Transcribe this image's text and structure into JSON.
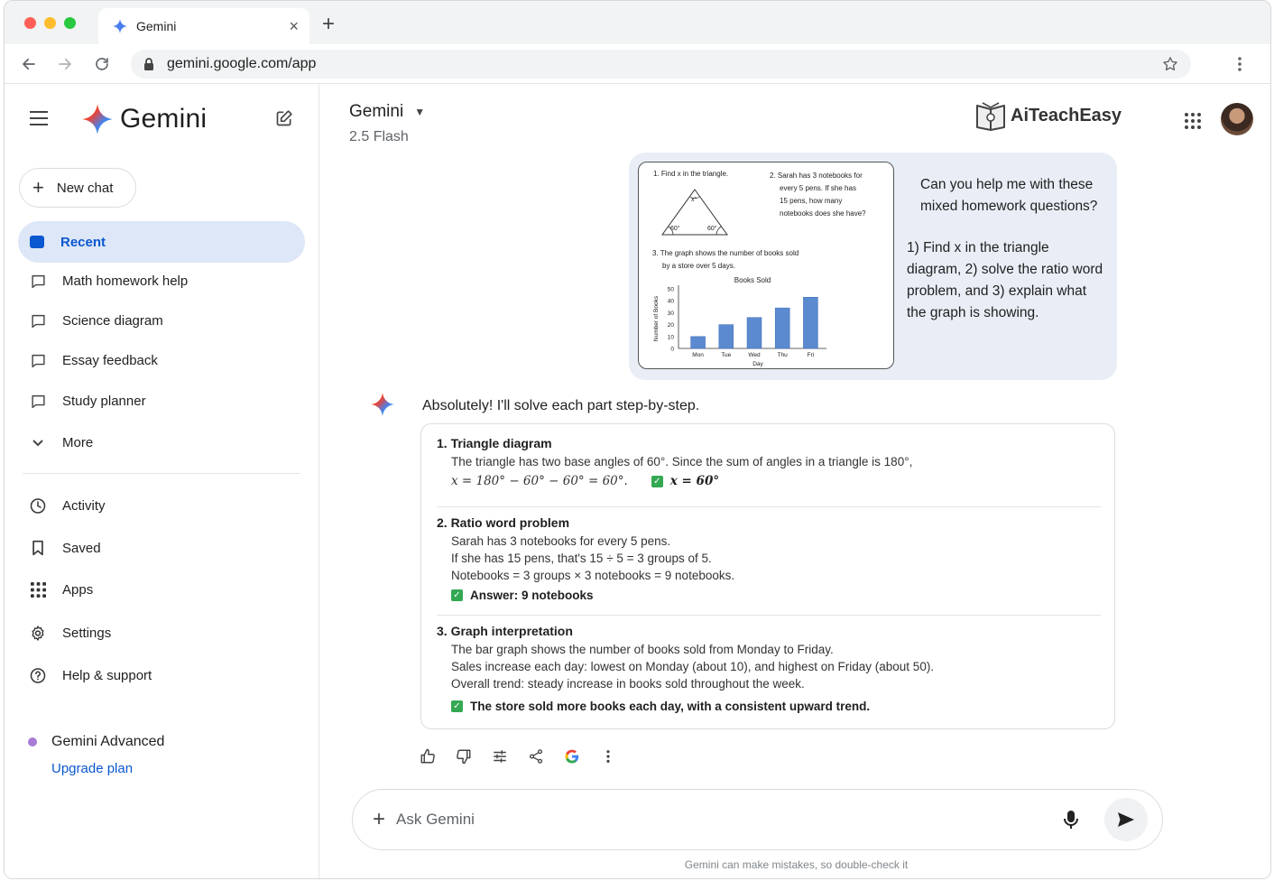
{
  "browser": {
    "tab_title": "Gemini",
    "tab_close": "×",
    "new_tab": "+",
    "url": "gemini.google.com/app"
  },
  "sidebar": {
    "brand": "Gemini",
    "new_chat": "New chat",
    "recent": "Recent",
    "chats": [
      "Math homework help",
      "Science diagram",
      "Essay feedback",
      "Study planner"
    ],
    "more": "More",
    "menu": [
      "Activity",
      "Saved",
      "Apps",
      "Settings",
      "Help & support"
    ],
    "advanced": "Gemini Advanced",
    "upgrade": "Upgrade plan"
  },
  "header": {
    "model_name": "Gemini",
    "model_version": "2.5 Flash",
    "partner_logo": "AiTeachEasy"
  },
  "user_message": {
    "question": "Can you help me with these mixed homework questions?",
    "details": "1) Find x in the triangle diagram, 2) solve the ratio word problem, and 3) explain what the graph is showing.",
    "worksheet": {
      "q1": "1. Find x in the triangle.",
      "angle_left": "60°",
      "angle_right": "60°",
      "angle_top": "x°",
      "q2_lines": [
        "2. Sarah has 3 notebooks for",
        "every 5 pens. If she has",
        "15 pens, how many",
        "notebooks does she have?"
      ],
      "q3_lines": [
        "3. The graph shows the number of books sold",
        "by a store over 5 days."
      ]
    }
  },
  "chart_data": {
    "type": "bar",
    "title": "Books Sold",
    "xlabel": "Day",
    "ylabel": "Number of Books",
    "categories": [
      "Mon",
      "Tue",
      "Wed",
      "Thu",
      "Fri"
    ],
    "values": [
      10,
      20,
      26,
      34,
      43
    ],
    "ylim": [
      0,
      50
    ],
    "yticks": [
      0,
      10,
      20,
      30,
      40,
      50
    ],
    "grid": false,
    "bar_color": "#5b8ad0"
  },
  "answer": {
    "intro": "Absolutely! I'll solve each part step-by-step.",
    "s1": {
      "heading": "1. Triangle diagram",
      "line1": "The triangle has two base angles of 60°. Since the sum of angles in a triangle is 180°,",
      "equation": "x = 180° − 60° − 60° = 60°.",
      "result": "x = 60°"
    },
    "s2": {
      "heading": "2. Ratio word problem",
      "line1": "Sarah has 3 notebooks for every 5 pens.",
      "line2": "If she has 15 pens, that's 15 ÷ 5 = 3 groups of 5.",
      "line3": "Notebooks = 3 groups × 3 notebooks = 9 notebooks.",
      "result": "Answer: 9 notebooks"
    },
    "s3": {
      "heading": "3. Graph interpretation",
      "line1": "The bar graph shows the number of books sold from Monday to Friday.",
      "line2": "Sales increase each day: lowest on Monday (about 10), and highest on Friday (about 50).",
      "line3": "Overall trend: steady increase in books sold throughout the week.",
      "result": "The store sold more books each day, with a consistent upward trend."
    }
  },
  "input": {
    "placeholder": "Ask Gemini",
    "disclaimer": "Gemini can make mistakes, so double-check it"
  },
  "colors": {
    "accent": "#0b57d0",
    "recent_bg": "#dde7f7",
    "bubble_bg": "#e9eef6",
    "check_green": "#34a853"
  }
}
